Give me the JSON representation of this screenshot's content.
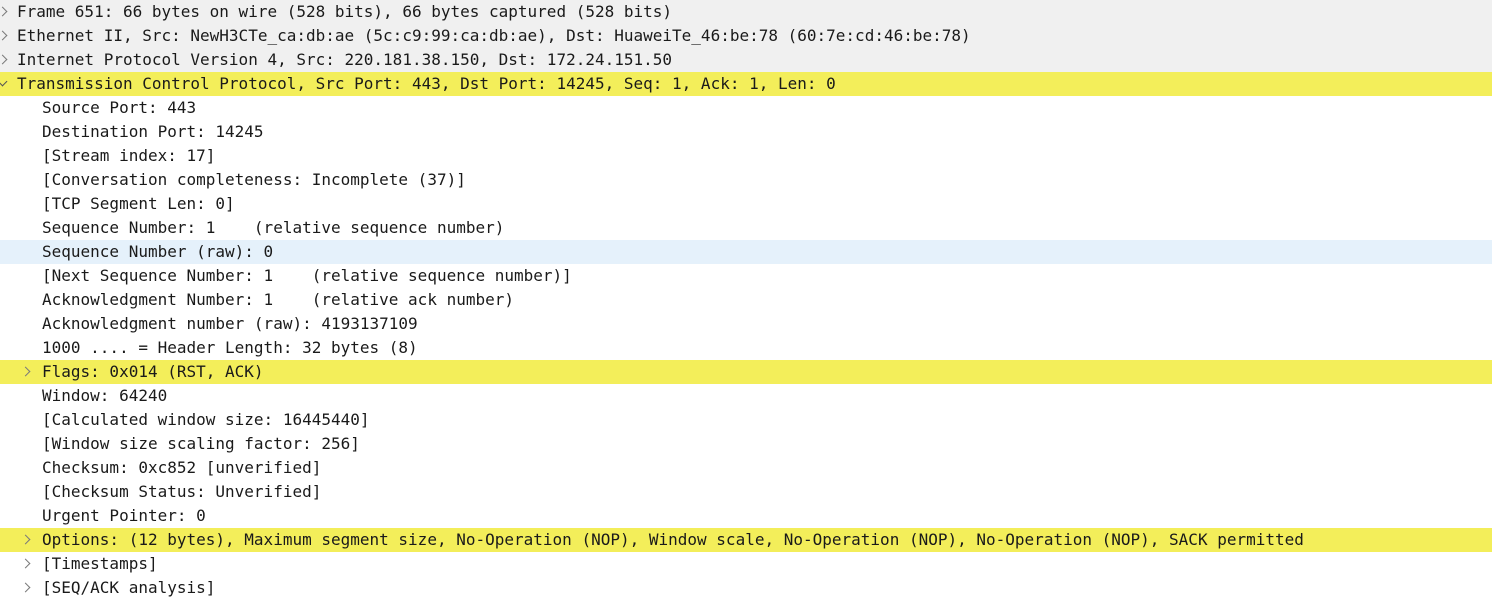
{
  "frame": "Frame 651: 66 bytes on wire (528 bits), 66 bytes captured (528 bits)",
  "ethernet": "Ethernet II, Src: NewH3CTe_ca:db:ae (5c:c9:99:ca:db:ae), Dst: HuaweiTe_46:be:78 (60:7e:cd:46:be:78)",
  "ip": "Internet Protocol Version 4, Src: 220.181.38.150, Dst: 172.24.151.50",
  "tcp": {
    "header": "Transmission Control Protocol, Src Port: 443, Dst Port: 14245, Seq: 1, Ack: 1, Len: 0",
    "source_port": "Source Port: 443",
    "destination_port": "Destination Port: 14245",
    "stream_index": "[Stream index: 17]",
    "conversation_completeness": "[Conversation completeness: Incomplete (37)]",
    "segment_len": "[TCP Segment Len: 0]",
    "seq_number": "Sequence Number: 1    (relative sequence number)",
    "seq_number_raw": "Sequence Number (raw): 0",
    "next_seq_number": "[Next Sequence Number: 1    (relative sequence number)]",
    "ack_number": "Acknowledgment Number: 1    (relative ack number)",
    "ack_number_raw": "Acknowledgment number (raw): 4193137109",
    "header_length": "1000 .... = Header Length: 32 bytes (8)",
    "flags": "Flags: 0x014 (RST, ACK)",
    "window": "Window: 64240",
    "calculated_window": "[Calculated window size: 16445440]",
    "window_scaling": "[Window size scaling factor: 256]",
    "checksum": "Checksum: 0xc852 [unverified]",
    "checksum_status": "[Checksum Status: Unverified]",
    "urgent_pointer": "Urgent Pointer: 0",
    "options": "Options: (12 bytes), Maximum segment size, No-Operation (NOP), Window scale, No-Operation (NOP), No-Operation (NOP), SACK permitted",
    "timestamps": "[Timestamps]",
    "seq_ack_analysis": "[SEQ/ACK analysis]"
  },
  "colors": {
    "highlight_yellow": "#f3ee5a",
    "highlight_blue": "#e5f1fb",
    "top_level_bg": "#f0f0f0"
  },
  "icons": {
    "collapsed": "chevron-right-icon",
    "expanded": "chevron-down-icon"
  }
}
